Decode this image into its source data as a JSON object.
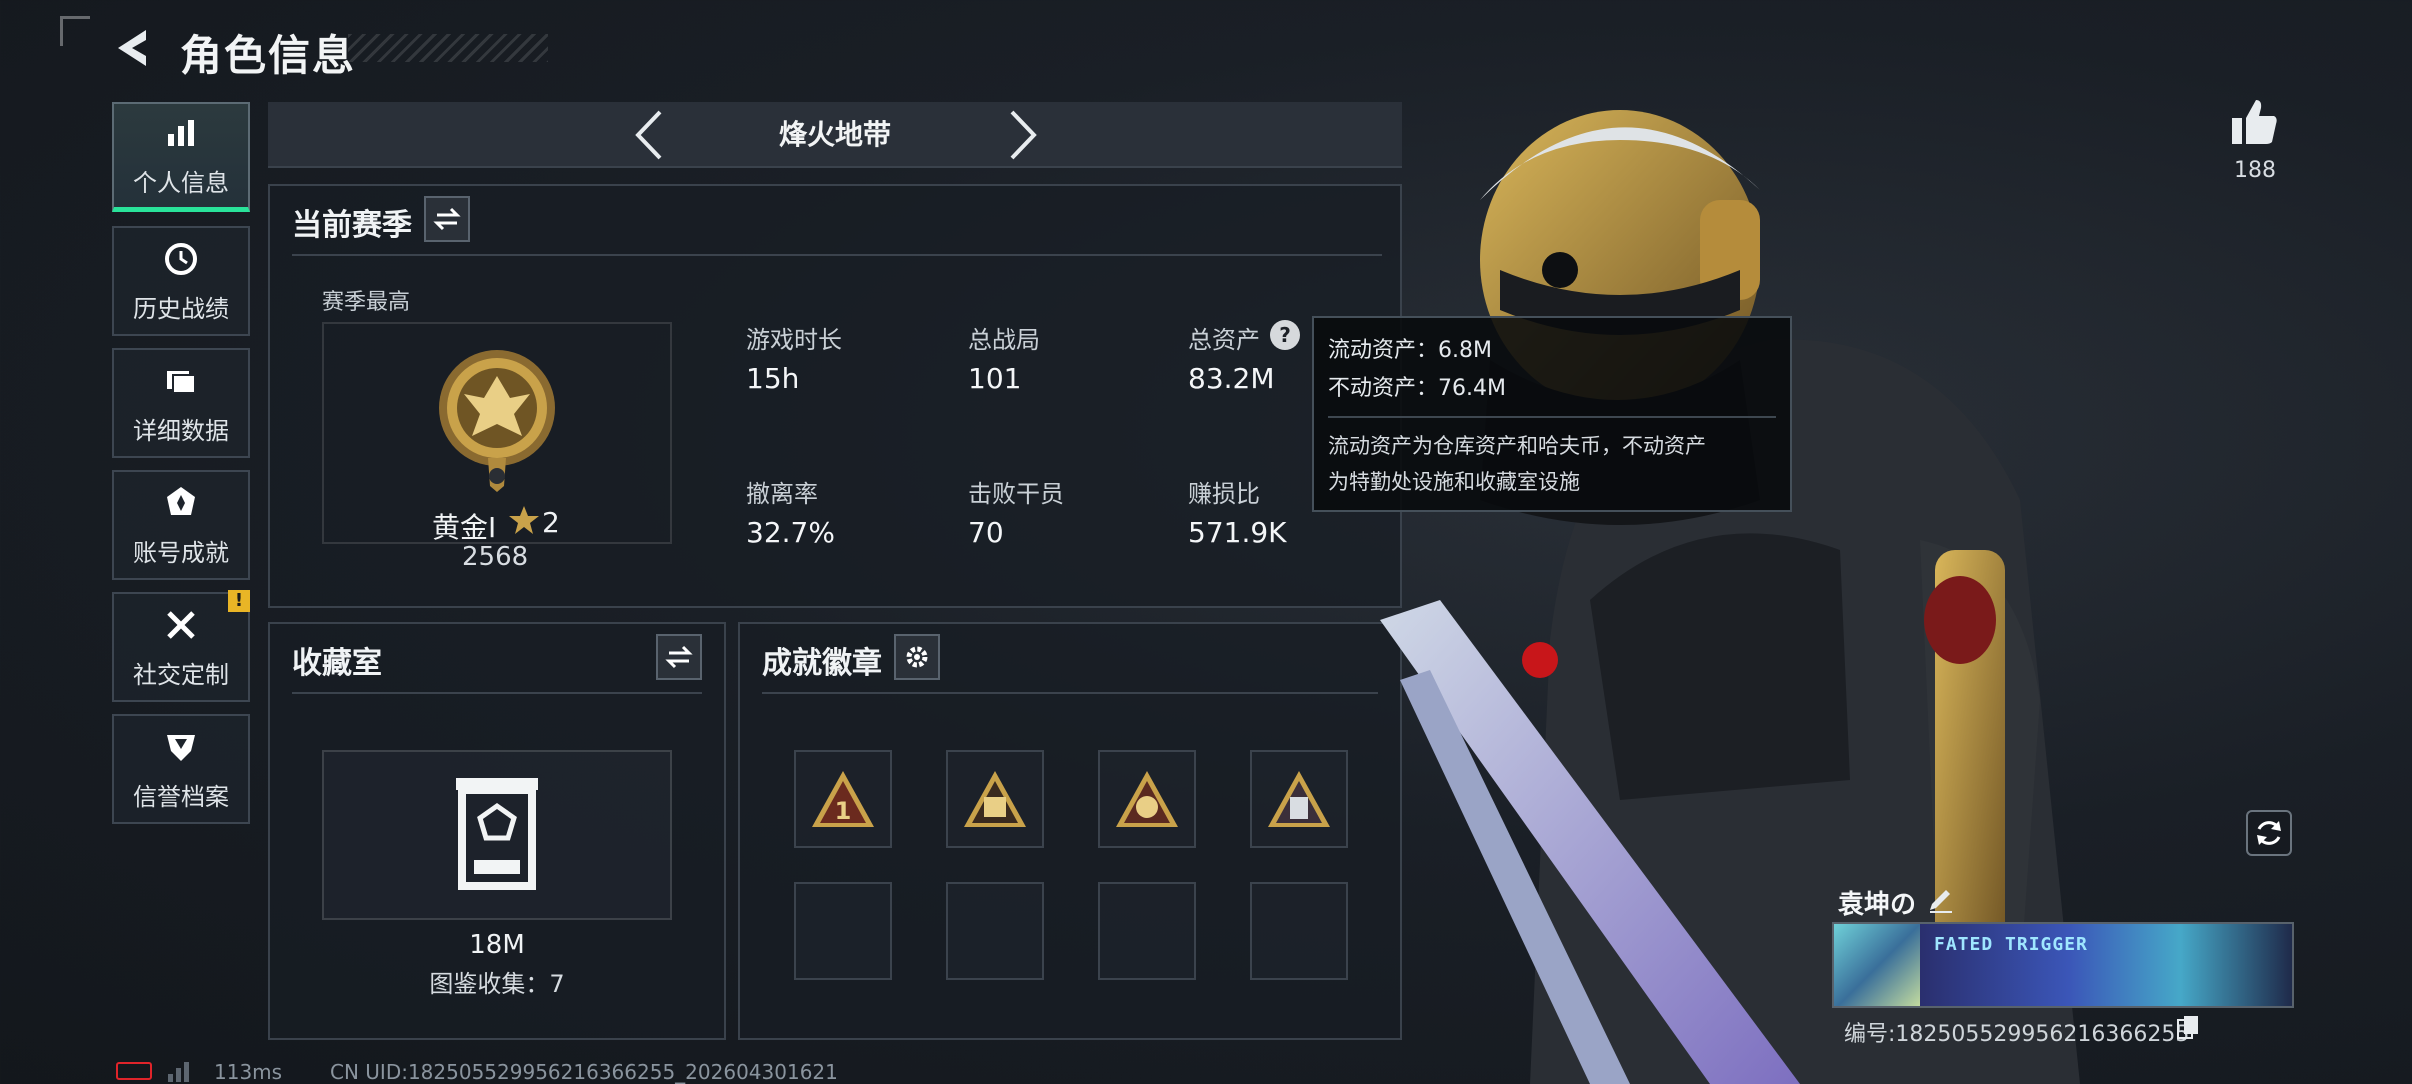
{
  "header": {
    "title": "角色信息"
  },
  "sidebar": {
    "items": [
      {
        "label": "个人信息",
        "icon": "bar-chart-icon",
        "active": true
      },
      {
        "label": "历史战绩",
        "icon": "history-icon"
      },
      {
        "label": "详细数据",
        "icon": "folder-icon"
      },
      {
        "label": "账号成就",
        "icon": "achievement-icon"
      },
      {
        "label": "社交定制",
        "icon": "tools-icon",
        "badge": "!"
      },
      {
        "label": "信誉档案",
        "icon": "shield-icon"
      }
    ]
  },
  "mode": {
    "name": "烽火地带"
  },
  "season": {
    "title": "当前赛季",
    "best_label": "赛季最高",
    "rank_name": "黄金Ⅰ",
    "rank_stars": "2",
    "rank_score": "2568",
    "stats": [
      {
        "label": "游戏时长",
        "value": "15h"
      },
      {
        "label": "总战局",
        "value": "101"
      },
      {
        "label": "总资产",
        "value": "83.2M"
      },
      {
        "label": "撤离率",
        "value": "32.7%"
      },
      {
        "label": "击败干员",
        "value": "70"
      },
      {
        "label": "赚损比",
        "value": "571.9K"
      }
    ]
  },
  "tooltip": {
    "liquid": "流动资产：6.8M",
    "fixed": "不动资产：76.4M",
    "desc_line1": "流动资产为仓库资产和哈夫币，不动资产",
    "desc_line2": "为特勤处设施和收藏室设施"
  },
  "collection": {
    "title": "收藏室",
    "value": "18M",
    "count_label": "图鉴收集：7"
  },
  "badges": {
    "title": "成就徽章"
  },
  "profile": {
    "likes": "188",
    "name": "袁坤の",
    "id_text": "编号:1825055299562163662​55",
    "banner_text": "FATED TRIGGER"
  },
  "status": {
    "ping": "113ms",
    "uid": "CN UID:18250552995621636625​5_202604301621"
  },
  "colors": {
    "accent": "#29e39a",
    "warning": "#e9b526",
    "gold": "#c9a24a"
  }
}
